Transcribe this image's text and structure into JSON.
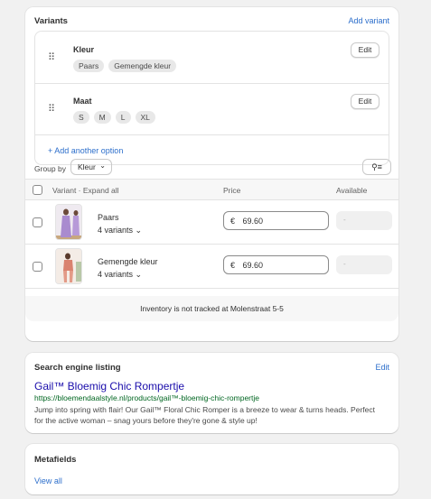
{
  "variants": {
    "title": "Variants",
    "add_variant": "Add variant",
    "options": [
      {
        "name": "Kleur",
        "values": [
          "Paars",
          "Gemengde kleur"
        ],
        "edit": "Edit"
      },
      {
        "name": "Maat",
        "values": [
          "S",
          "M",
          "L",
          "XL"
        ],
        "edit": "Edit"
      }
    ],
    "add_option": "+ Add another option",
    "group_by_label": "Group by",
    "group_by_value": "Kleur",
    "table_header": {
      "variant": "Variant · Expand all",
      "price": "Price",
      "available": "Available"
    },
    "rows": [
      {
        "name": "Paars",
        "count": "4 variants",
        "currency": "€",
        "price": "69.60",
        "available": "-"
      },
      {
        "name": "Gemengde kleur",
        "count": "4 variants",
        "currency": "€",
        "price": "69.60",
        "available": "-"
      }
    ],
    "inventory_note": "Inventory is not tracked at Molenstraat 5-5"
  },
  "seo": {
    "title": "Search engine listing",
    "edit": "Edit",
    "page_title": "Gail™ Bloemig Chic Rompertje",
    "url": "https://bloemendaalstyle.nl/products/gail™-bloemig-chic-rompertje",
    "description": "Jump into spring with flair! Our Gail™ Floral Chic Romper is a breeze to wear & turns heads. Perfect for the active woman – snag yours before they're gone & style up!"
  },
  "metafields": {
    "title": "Metafields",
    "view_all": "View all"
  }
}
